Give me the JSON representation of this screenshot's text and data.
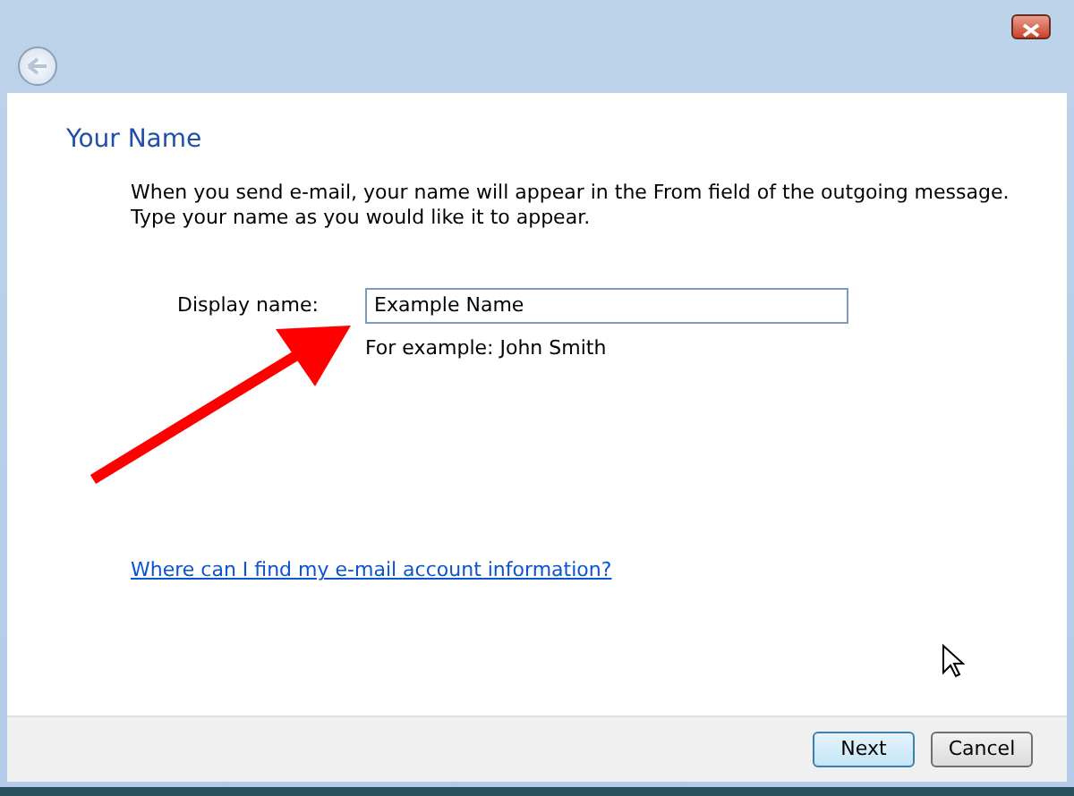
{
  "heading": "Your Name",
  "intro_lines": [
    "When you send e-mail, your name will appear in the From field of the outgoing message.",
    "Type your name as you would like it to appear."
  ],
  "display_name": {
    "label": "Display name:",
    "value": "Example Name",
    "hint": "For example: John Smith"
  },
  "help_link": "Where can I find my e-mail account information?",
  "buttons": [
    {
      "label": "Next",
      "default": true
    },
    {
      "label": "Cancel",
      "default": false
    }
  ]
}
